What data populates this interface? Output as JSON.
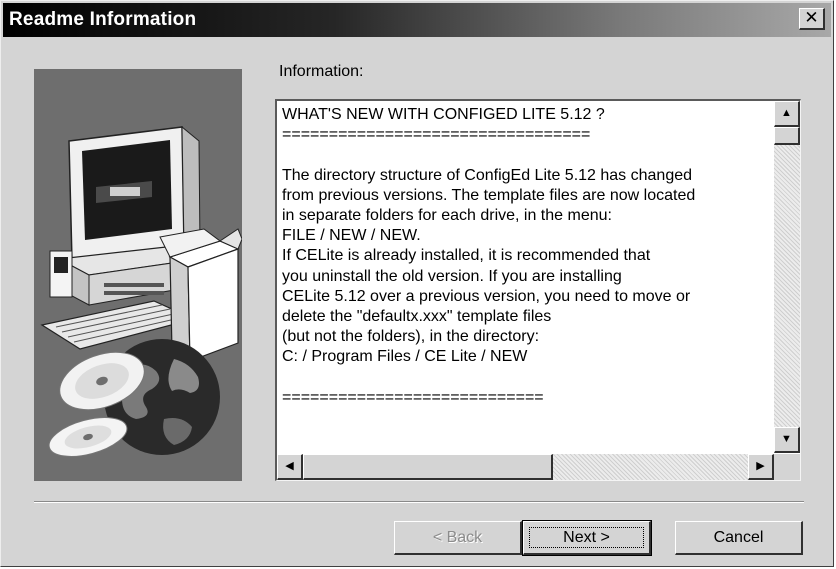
{
  "window": {
    "title": "Readme Information",
    "close_symbol": "✕"
  },
  "info_label": "Information:",
  "readme": {
    "text": "WHAT'S NEW WITH CONFIGED LITE 5.12 ?\n=================================\n\nThe directory structure of ConfigEd Lite 5.12 has changed\nfrom previous versions. The template files are now located\nin separate folders for each drive, in the menu:\nFILE / NEW / NEW.\nIf CELite is already installed, it is recommended that\nyou uninstall the old version. If you are installing\nCELite 5.12 over a previous version, you need to move or\ndelete the \"defaultx.xxx\" template files\n(but not the folders), in the directory:\nC: / Program Files / CE Lite / NEW\n\n============================"
  },
  "scroll": {
    "up_arrow": "▲",
    "down_arrow": "▼",
    "left_arrow": "◀",
    "right_arrow": "▶"
  },
  "buttons": {
    "back": "< Back",
    "next": "Next >",
    "cancel": "Cancel",
    "back_enabled": false
  },
  "icons": [
    "close-icon",
    "computer-illustration-icon",
    "box-icon",
    "cd-icon",
    "globe-icon"
  ],
  "colors": {
    "face": "#d4d4d4",
    "titlebar_start": "#000000",
    "titlebar_end": "#a8a8a8",
    "side_panel": "#6e6e6e"
  }
}
